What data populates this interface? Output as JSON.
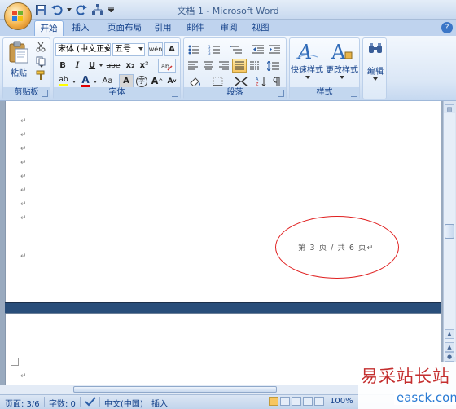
{
  "window": {
    "title": "文档 1 - Microsoft Word"
  },
  "ribbon_tabs": [
    "开始",
    "插入",
    "页面布局",
    "引用",
    "邮件",
    "审阅",
    "视图"
  ],
  "clipboard": {
    "paste_label": "粘贴",
    "group_label": "剪贴板"
  },
  "font": {
    "font_name": "宋体 (中文正文",
    "font_size": "五号",
    "group_label": "字体",
    "btn_bold": "B",
    "btn_italic": "I",
    "btn_underline": "U",
    "btn_strike": "abe",
    "btn_subscript": "x₂",
    "btn_superscript": "x²",
    "btn_change_case": "Aa",
    "btn_grow": "A",
    "btn_shrink": "A",
    "btn_highlight": "ab",
    "btn_font_color": "A",
    "btn_char_shading": "A",
    "btn_phonetic": "wén",
    "btn_border": "A",
    "btn_enclose": "字"
  },
  "paragraph": {
    "group_label": "段落"
  },
  "styles": {
    "quick_styles_label": "快速样式",
    "change_styles_label": "更改样式",
    "group_label": "样式"
  },
  "editing": {
    "label": "编辑"
  },
  "document": {
    "footer_text": "第 3 页 / 共 6 页↵",
    "para_mark": "↵"
  },
  "status": {
    "page": "页面: 3/6",
    "words": "字数: 0",
    "language": "中文(中国)",
    "mode": "插入",
    "zoom": "100%"
  },
  "watermark": {
    "cn": "易采站长站",
    "en": "easck.com"
  },
  "colors": {
    "highlight": "#ffff00",
    "font_color": "#e00000",
    "annotation": "#e02020"
  }
}
